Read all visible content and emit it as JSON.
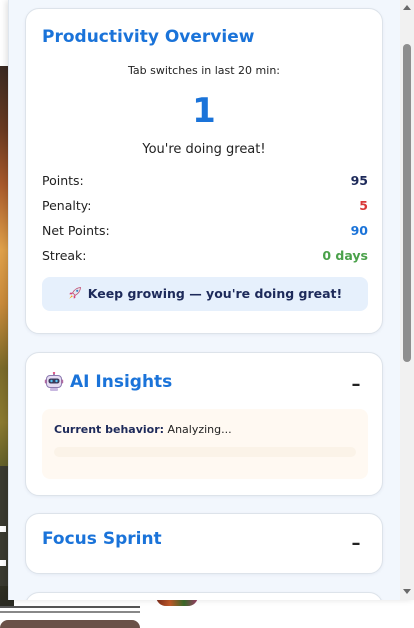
{
  "overview": {
    "title": "Productivity Overview",
    "subtitle": "Tab switches in last 20 min:",
    "tab_switches": "1",
    "message": "You're doing great!",
    "stats": [
      {
        "label": "Points:",
        "value": "95",
        "color": "#1d2a5a"
      },
      {
        "label": "Penalty:",
        "value": "5",
        "color": "#d93838"
      },
      {
        "label": "Net Points:",
        "value": "90",
        "color": "#1a73d9"
      },
      {
        "label": "Streak:",
        "value": "0 days",
        "color": "#4aa14a"
      }
    ],
    "banner": {
      "icon": "rocket-icon",
      "text": "Keep growing — you're doing great!"
    }
  },
  "insights": {
    "title": "AI Insights",
    "icon": "robot-icon",
    "collapse_label": "–",
    "behavior_label": "Current behavior:",
    "behavior_value": "Analyzing..."
  },
  "sprint": {
    "title": "Focus Sprint",
    "collapse_label": "–"
  },
  "colors": {
    "accent": "#1a73d9",
    "panel_bg": "#f2f7fd",
    "banner_bg": "#e6f0fc"
  }
}
